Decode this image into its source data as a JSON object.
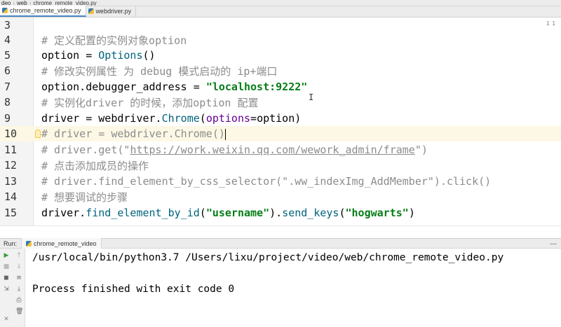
{
  "breadcrumb": {
    "project": "deo",
    "folder": "web",
    "file": "chrome_remote_video.py"
  },
  "tabs": [
    {
      "label": "chrome_remote_video.py",
      "active": true
    },
    {
      "label": "webdriver.py",
      "active": false
    }
  ],
  "editor": {
    "lines": [
      {
        "num": "3"
      },
      {
        "num": "4",
        "comment": "# 定义配置的实例对象option"
      },
      {
        "num": "5",
        "var": "option",
        "op": " = ",
        "call": "Options",
        "tail": "()"
      },
      {
        "num": "6",
        "comment": "# 修改实例属性 为 debug 模式启动的 ip+端口"
      },
      {
        "num": "7",
        "var": "option.debugger_address",
        "op": " = ",
        "str": "\"localhost:9222\""
      },
      {
        "num": "8",
        "comment": "# 实例化driver 的时候，添加option 配置"
      },
      {
        "num": "9",
        "var": "driver",
        "op": " = ",
        "obj": "webdriver.",
        "call": "Chrome",
        "open": "(",
        "kw": "options",
        "eq": "=",
        "arg": "option",
        "close": ")"
      },
      {
        "num": "10",
        "comment": "# driver = webdriver.Chrome()"
      },
      {
        "num": "11",
        "comment_pre": "# driver.get(\"",
        "url": "https://work.weixin.qq.com/wework_admin/frame",
        "comment_post": "\")"
      },
      {
        "num": "12",
        "comment": "# 点击添加成员的操作"
      },
      {
        "num": "13",
        "comment": "# driver.find_element_by_css_selector(\".ww_indexImg_AddMember\").click()"
      },
      {
        "num": "14",
        "comment": "# 想要调试的步骤"
      },
      {
        "num": "15",
        "obj": "driver.",
        "call": "find_element_by_id",
        "open": "(",
        "str": "\"username\"",
        "mid": ").",
        "call2": "send_keys",
        "open2": "(",
        "str2": "\"hogwarts\"",
        "close": ")"
      }
    ],
    "warnings": {
      "count": "1",
      "weak": "1"
    }
  },
  "run": {
    "label": "Run:",
    "tab": "chrome_remote_video",
    "console": [
      "/usr/local/bin/python3.7 /Users/lixu/project/video/web/chrome_remote_video.py",
      "",
      "Process finished with exit code 0"
    ]
  },
  "colors": {
    "comment": "#8c8c8c",
    "string": "#067d17",
    "call": "#00627a",
    "keyword": "#660099",
    "current_line": "#fcf8e5"
  }
}
